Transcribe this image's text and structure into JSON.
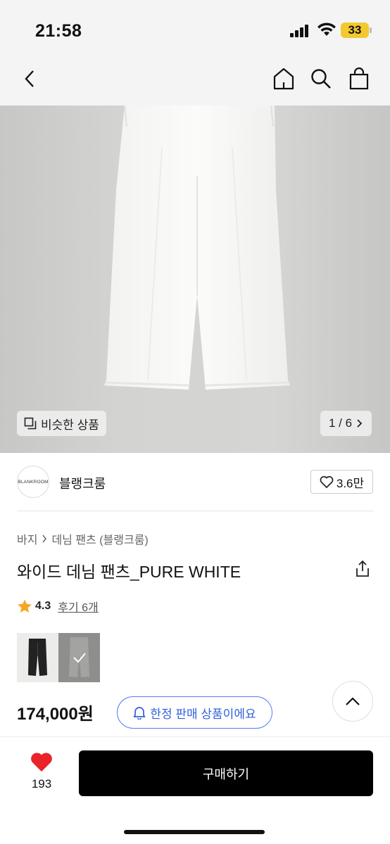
{
  "status": {
    "time": "21:58",
    "battery": "33"
  },
  "nav": {
    "back_icon": "chevron-left-icon",
    "home_icon": "home-icon",
    "search_icon": "search-icon",
    "bag_icon": "shopping-bag-icon"
  },
  "gallery": {
    "similar_label": "비슷한 상품",
    "page_indicator": "1 / 6"
  },
  "brand": {
    "logo_text": "BLANKROOM",
    "name": "블랭크룸",
    "likes": "3.6만"
  },
  "breadcrumb": {
    "category": "바지",
    "subcategory": "데님 팬츠 (블랭크룸)"
  },
  "product": {
    "title": "와이드 데님 팬츠_PURE WHITE",
    "rating": "4.3",
    "reviews": "후기 6개",
    "price": "174,000원",
    "limited_label": "한정 판매 상품이에요"
  },
  "bottom": {
    "wish_count": "193",
    "buy_label": "구매하기"
  },
  "colors": {
    "accent_blue": "#3062d9",
    "heart_red": "#e8232a",
    "star": "#f5a623"
  }
}
